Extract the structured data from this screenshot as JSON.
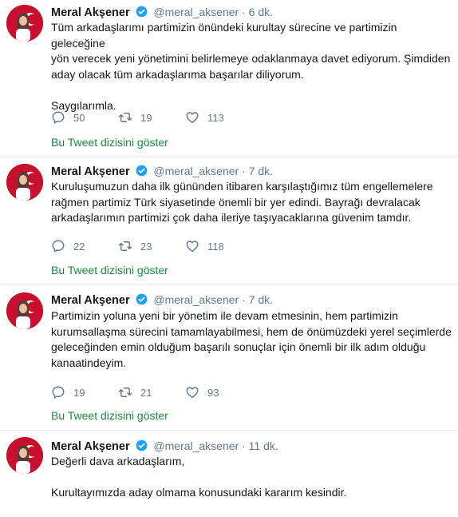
{
  "colors": {
    "link": "#1c8a3a",
    "verified": "#1da1f2",
    "muted": "#657786"
  },
  "tweets": [
    {
      "name": "Meral Akşener",
      "handle": "@meral_aksener",
      "dot": "·",
      "time": "6 dk.",
      "text": "Tüm arkadaşlarımı partimizin önündeki kurultay sürecine ve partimizin geleceğine\nyön verecek yeni yönetimini belirlemeye odaklanmaya davet ediyorum. Şimdiden\naday olacak tüm arkadaşlarıma başarılar diliyorum.\n\nSaygılarımla.",
      "replies": "50",
      "retweets": "19",
      "likes": "113",
      "show_thread": "Bu Tweet dizisini göster"
    },
    {
      "name": "Meral Akşener",
      "handle": "@meral_aksener",
      "dot": "·",
      "time": "7 dk.",
      "text": "Kuruluşumuzun daha ilk gününden itibaren karşılaştığımız tüm engellemelere\nrağmen partimiz Türk siyasetinde önemli bir yer edindi. Bayrağı devralacak\narkadaşlarımın partimizi çok daha ileriye taşıyacaklarına güvenim tamdır.",
      "replies": "22",
      "retweets": "23",
      "likes": "118",
      "show_thread": "Bu Tweet dizisini göster"
    },
    {
      "name": "Meral Akşener",
      "handle": "@meral_aksener",
      "dot": "·",
      "time": "7 dk.",
      "text": "Partimizin yoluna yeni bir yönetim ile devam etmesinin, hem partimizin\nkurumsallaşma sürecini tamamlayabilmesi, hem de önümüzdeki yerel seçimlerde\ngeleceğinden emin olduğum başarılı sonuçlar için önemli bir ilk adım olduğu\nkanaatindeyim.",
      "replies": "19",
      "retweets": "21",
      "likes": "93",
      "show_thread": "Bu Tweet dizisini göster"
    },
    {
      "name": "Meral Akşener",
      "handle": "@meral_aksener",
      "dot": "·",
      "time": "11 dk.",
      "text": "Değerli dava arkadaşlarım,\n\nKurultayımızda aday olmama konusundaki kararım kesindir."
    }
  ]
}
